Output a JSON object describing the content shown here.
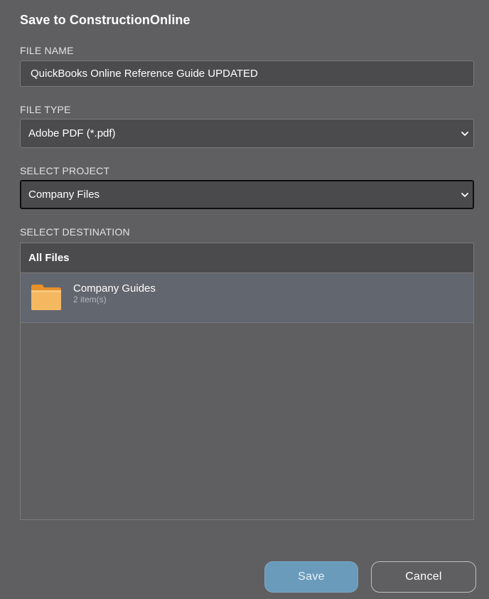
{
  "dialog": {
    "title": "Save to ConstructionOnline"
  },
  "file_name": {
    "label": "FILE NAME",
    "value": "QuickBooks Online Reference Guide UPDATED"
  },
  "file_type": {
    "label": "FILE TYPE",
    "selected": "Adobe PDF (*.pdf)"
  },
  "project": {
    "label": "SELECT PROJECT",
    "selected": "Company Files"
  },
  "destination": {
    "label": "SELECT DESTINATION",
    "header": "All Files",
    "items": [
      {
        "name": "Company Guides",
        "count": "2 item(s)",
        "icon": "folder-icon"
      }
    ]
  },
  "actions": {
    "save_label": "Save",
    "cancel_label": "Cancel"
  },
  "colors": {
    "background": "#5f5f61",
    "input_bg": "#4b4b4d",
    "selected_row": "#62666e",
    "save_button": "#6a9bbb",
    "folder": "#f4b860"
  }
}
